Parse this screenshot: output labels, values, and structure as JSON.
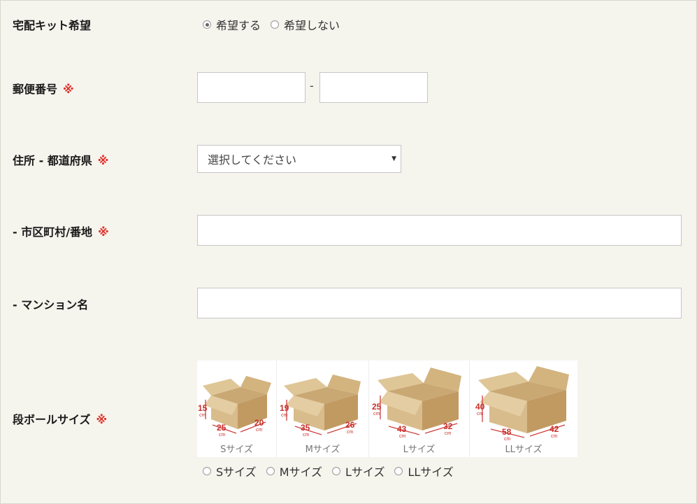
{
  "kit": {
    "label": "宅配キット希望",
    "options": [
      "希望する",
      "希望しない"
    ],
    "selected": 0
  },
  "postal": {
    "label": "郵便番号",
    "required_mark": "※",
    "separator": "-"
  },
  "prefecture": {
    "label": "住所 - 都道府県",
    "required_mark": "※",
    "placeholder": "選択してください"
  },
  "city": {
    "label": "- 市区町村/番地",
    "required_mark": "※"
  },
  "building": {
    "label": "- マンション名"
  },
  "box_size": {
    "label": "段ボールサイズ",
    "required_mark": "※",
    "images": [
      {
        "caption": "Sサイズ",
        "height": "15",
        "width": "25",
        "depth": "20",
        "unit": "cm"
      },
      {
        "caption": "Mサイズ",
        "height": "19",
        "width": "35",
        "depth": "26",
        "unit": "cm"
      },
      {
        "caption": "Lサイズ",
        "height": "25",
        "width": "43",
        "depth": "32",
        "unit": "cm"
      },
      {
        "caption": "LLサイズ",
        "height": "40",
        "width": "58",
        "depth": "42",
        "unit": "cm"
      }
    ],
    "options": [
      "Sサイズ",
      "Mサイズ",
      "Lサイズ",
      "LLサイズ"
    ]
  }
}
